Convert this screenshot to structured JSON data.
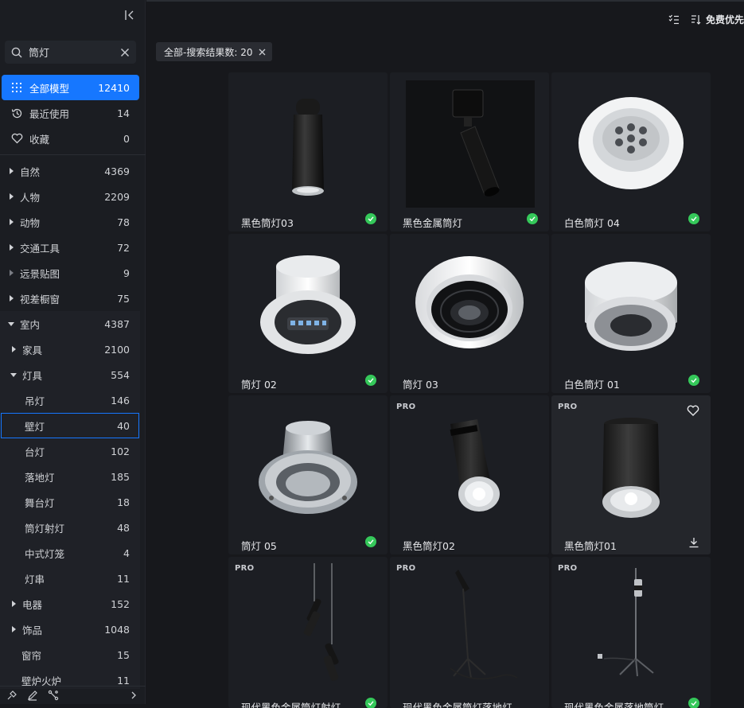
{
  "sidebar": {
    "search": {
      "value": "筒灯",
      "placeholder": ""
    },
    "primary": [
      {
        "label": "全部模型",
        "count": "12410",
        "icon": "grid-dots-icon",
        "active": true
      },
      {
        "label": "最近使用",
        "count": "14",
        "icon": "history-icon"
      },
      {
        "label": "收藏",
        "count": "0",
        "icon": "heart-icon"
      }
    ],
    "categories": [
      {
        "label": "自然",
        "count": "4369"
      },
      {
        "label": "人物",
        "count": "2209"
      },
      {
        "label": "动物",
        "count": "78"
      },
      {
        "label": "交通工具",
        "count": "72"
      },
      {
        "label": "远景贴图",
        "count": "9"
      },
      {
        "label": "视差橱窗",
        "count": "75"
      },
      {
        "label": "室内",
        "count": "4387"
      },
      {
        "label": "家具",
        "count": "2100"
      },
      {
        "label": "灯具",
        "count": "554"
      },
      {
        "label": "吊灯",
        "count": "146"
      },
      {
        "label": "壁灯",
        "count": "40"
      },
      {
        "label": "台灯",
        "count": "102"
      },
      {
        "label": "落地灯",
        "count": "185"
      },
      {
        "label": "舞台灯",
        "count": "18"
      },
      {
        "label": "筒灯射灯",
        "count": "48"
      },
      {
        "label": "中式灯笼",
        "count": "4"
      },
      {
        "label": "灯串",
        "count": "11"
      },
      {
        "label": "电器",
        "count": "152"
      },
      {
        "label": "饰品",
        "count": "1048"
      },
      {
        "label": "窗帘",
        "count": "15"
      },
      {
        "label": "壁炉火炉",
        "count": "11"
      }
    ]
  },
  "topbar": {
    "sort_label": "免费优先"
  },
  "filter_tag": {
    "label": "全部-搜索结果数: 20"
  },
  "cards": [
    {
      "name": "黑色筒灯03",
      "pro": "",
      "status": "check"
    },
    {
      "name": "黑色金属筒灯",
      "pro": "",
      "status": "check"
    },
    {
      "name": "白色筒灯 04",
      "pro": "",
      "status": "check"
    },
    {
      "name": "筒灯 02",
      "pro": "",
      "status": "check"
    },
    {
      "name": "筒灯 03",
      "pro": "",
      "status": "none"
    },
    {
      "name": "白色筒灯 01",
      "pro": "",
      "status": "check"
    },
    {
      "name": "筒灯 05",
      "pro": "",
      "status": "check"
    },
    {
      "name": "黑色筒灯02",
      "pro": "PRO",
      "status": "none"
    },
    {
      "name": "黑色筒灯01",
      "pro": "PRO",
      "status": "download"
    },
    {
      "name": "现代黑色金属筒灯射灯",
      "pro": "PRO",
      "status": "check"
    },
    {
      "name": "现代黑色金属筒灯落地灯",
      "pro": "PRO",
      "status": "none"
    },
    {
      "name": "现代黑色金属落地筒灯",
      "pro": "PRO",
      "status": "check"
    }
  ],
  "colors": {
    "accent": "#1677ff",
    "success": "#35c85a",
    "background": "#17181c",
    "sidebar": "#1b1d22"
  }
}
